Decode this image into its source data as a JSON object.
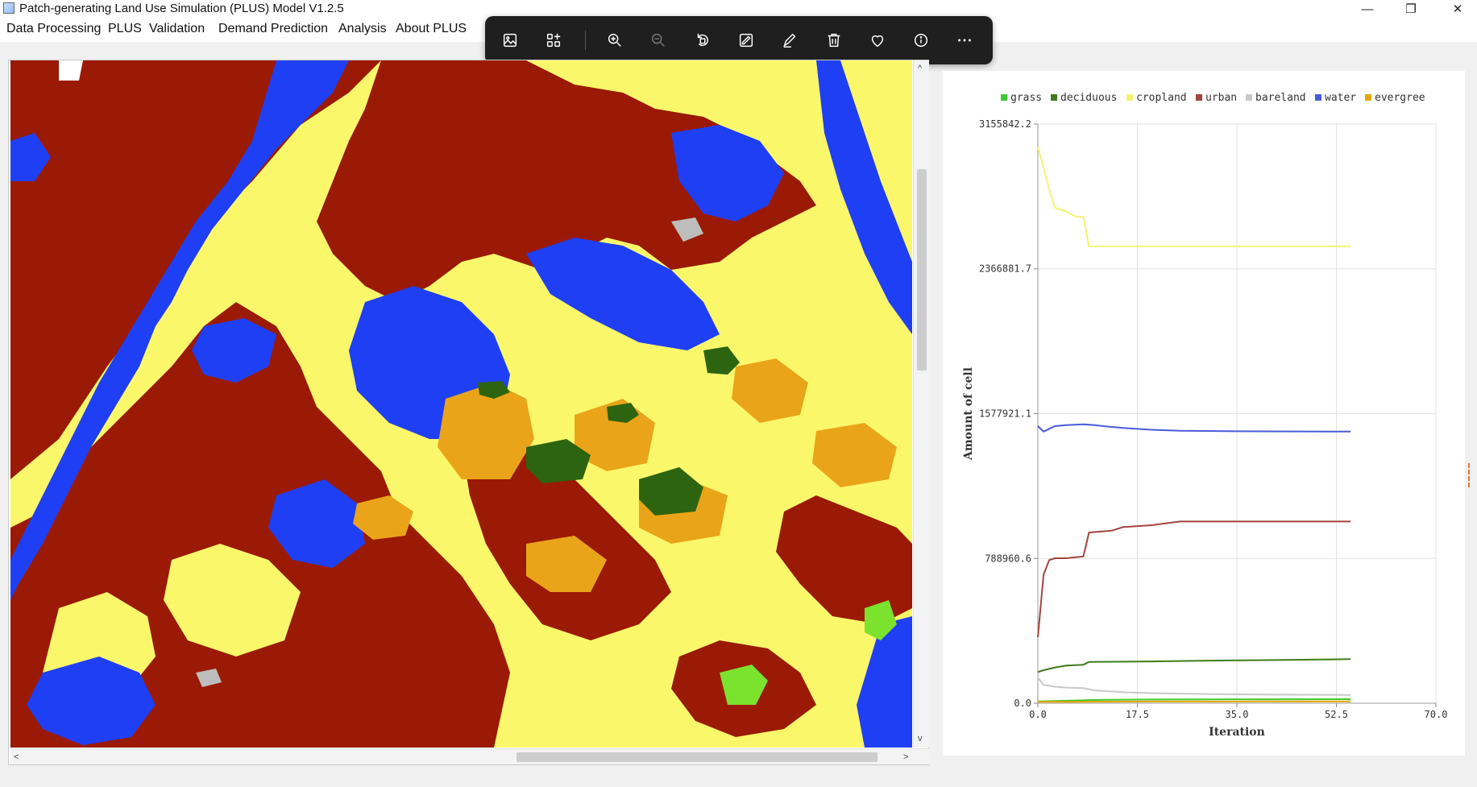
{
  "window": {
    "title": "Patch-generating Land Use Simulation (PLUS) Model V1.2.5",
    "controls": {
      "minimize": "—",
      "restore": "❐",
      "close": "✕"
    }
  },
  "menu": {
    "items": [
      "Data Processing",
      "PLUS",
      "Validation",
      "Demand Prediction",
      "Analysis",
      "About PLUS"
    ]
  },
  "viewer_toolbar": {
    "icons": [
      "image-icon",
      "apps-icon",
      "zoom-in-icon",
      "zoom-out-icon",
      "rotate-icon",
      "edit-image-icon",
      "draw-icon",
      "delete-icon",
      "heart-icon",
      "info-icon",
      "more-icon"
    ]
  },
  "map": {
    "classes": {
      "urban": "#9b1a06",
      "water": "#1f3ff5",
      "cropland": "#fbf76a",
      "evergreen": "#eaa419",
      "deciduous": "#2d6410",
      "grass": "#7be22d",
      "bareland": "#bdbdbd"
    },
    "scroll_left": "<",
    "scroll_right": ">",
    "scroll_down": "v"
  },
  "chart_data": {
    "type": "line",
    "title": "",
    "xlabel": "Iteration",
    "ylabel": "Amount of cell",
    "xlim": [
      0,
      70
    ],
    "ylim": [
      0,
      3155842.2
    ],
    "xticks": [
      "0.0",
      "17.5",
      "35.0",
      "52.5",
      "70.0"
    ],
    "yticks": [
      "0.0",
      "788960.6",
      "1577921.1",
      "2366881.7",
      "3155842.2"
    ],
    "legend_position": "top",
    "series": [
      {
        "name": "grass",
        "color": "#3ecb2f",
        "x": [
          0,
          3,
          6,
          9,
          12,
          20,
          30,
          40,
          55
        ],
        "y": [
          10000,
          12000,
          14000,
          17000,
          19000,
          20000,
          21000,
          21500,
          22000
        ]
      },
      {
        "name": "deciduous",
        "color": "#3e7c1c",
        "x": [
          0,
          1,
          3,
          5,
          8,
          9,
          20,
          30,
          40,
          55
        ],
        "y": [
          170000,
          180000,
          195000,
          205000,
          210000,
          225000,
          228000,
          232000,
          235000,
          240000
        ]
      },
      {
        "name": "cropland",
        "color": "#f3f373",
        "x": [
          0,
          1,
          2,
          3,
          5,
          6,
          7,
          8,
          9,
          15,
          25,
          40,
          55
        ],
        "y": [
          3030000,
          2920000,
          2800000,
          2700000,
          2680000,
          2660000,
          2650000,
          2650000,
          2490000,
          2490000,
          2490000,
          2490000,
          2490000
        ]
      },
      {
        "name": "urban",
        "color": "#a4443d",
        "x": [
          0,
          1,
          2,
          3,
          5,
          8,
          9,
          13,
          15,
          20,
          25,
          35,
          45,
          55
        ],
        "y": [
          360000,
          700000,
          780000,
          790000,
          790000,
          800000,
          930000,
          940000,
          960000,
          970000,
          990000,
          990000,
          990000,
          990000
        ]
      },
      {
        "name": "bareland",
        "color": "#c8c8c8",
        "x": [
          0,
          1,
          3,
          5,
          8,
          10,
          15,
          20,
          30,
          40,
          55
        ],
        "y": [
          140000,
          100000,
          90000,
          85000,
          82000,
          70000,
          60000,
          55000,
          50000,
          47000,
          45000
        ]
      },
      {
        "name": "water",
        "color": "#4a5bd9",
        "x": [
          0,
          1,
          3,
          5,
          8,
          10,
          12,
          15,
          20,
          25,
          35,
          45,
          55
        ],
        "y": [
          1510000,
          1480000,
          1510000,
          1515000,
          1520000,
          1515000,
          1508000,
          1500000,
          1490000,
          1485000,
          1482000,
          1481000,
          1480000
        ]
      },
      {
        "name": "evergree",
        "color": "#e5a400",
        "x": [
          0,
          5,
          10,
          20,
          30,
          40,
          55
        ],
        "y": [
          8000,
          8000,
          8500,
          9000,
          9000,
          9500,
          10000
        ]
      }
    ]
  }
}
